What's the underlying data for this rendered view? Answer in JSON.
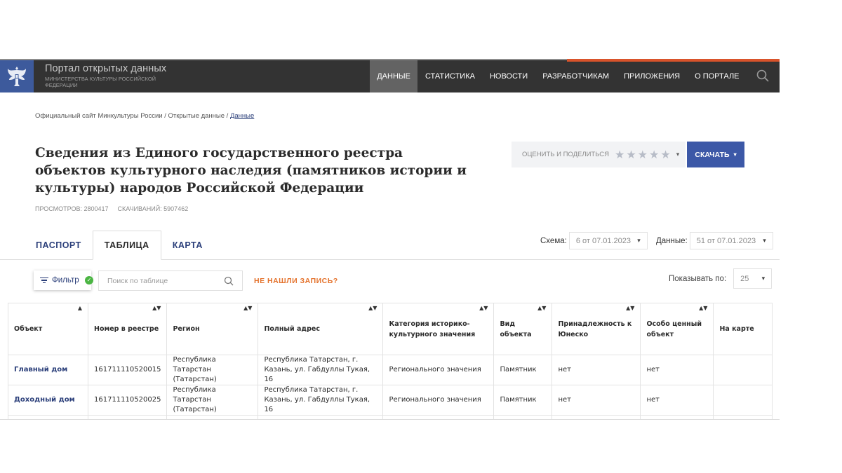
{
  "header": {
    "portal_title": "Портал открытых данных",
    "portal_subtitle": "МИНИСТЕРСТВА КУЛЬТУРЫ РОССИЙСКОЙ ФЕДЕРАЦИИ",
    "nav": [
      {
        "label": "ДАННЫЕ",
        "active": true
      },
      {
        "label": "СТАТИСТИКА",
        "active": false
      },
      {
        "label": "НОВОСТИ",
        "active": false
      },
      {
        "label": "РАЗРАБОТЧИКАМ",
        "active": false
      },
      {
        "label": "ПРИЛОЖЕНИЯ",
        "active": false
      },
      {
        "label": "О ПОРТАЛЕ",
        "active": false
      }
    ],
    "search_icon": "search-icon",
    "accent_color": "#d9532b",
    "brand_color": "#3d5a9c"
  },
  "breadcrumb": {
    "part1": "Официальный сайт Минкультуры России",
    "sep": " / ",
    "part2": "Открытые данные",
    "current": "Данные"
  },
  "dataset": {
    "title": "Сведения из Единого государственного реестра объектов культурного наследия (памятников истории и культуры) народов Российской Федерации",
    "views": "ПРОСМОТРОВ: 2800417",
    "downloads": "СКАЧИВАНИЙ: 5907462"
  },
  "actions": {
    "rate_label": "ОЦЕНИТЬ И ПОДЕЛИТЬСЯ",
    "rating_stars": 5,
    "download_label": "СКАЧАТЬ",
    "download_color": "#3c58a7"
  },
  "tabs": [
    {
      "label": "ПАСПОРТ",
      "active": false
    },
    {
      "label": "ТАБЛИЦА",
      "active": true
    },
    {
      "label": "КАРТА",
      "active": false
    }
  ],
  "versions": {
    "scheme_label": "Схема:",
    "scheme_value": "6 от 07.01.2023",
    "data_label": "Данные:",
    "data_value": "51 от 07.01.2023"
  },
  "toolbar": {
    "filter_label": "Фильтр",
    "search_placeholder": "Поиск по таблице",
    "not_found_label": "НЕ НАШЛИ ЗАПИСЬ?",
    "per_page_label": "Показывать по:",
    "per_page_value": "25"
  },
  "table": {
    "columns": [
      {
        "label": "Объект",
        "sort": "▲"
      },
      {
        "label": "Номер в реестре",
        "sort": "▲▼"
      },
      {
        "label": "Регион",
        "sort": "▲▼"
      },
      {
        "label": "Полный адрес",
        "sort": "▲▼"
      },
      {
        "label": "Категория историко-культурного значения",
        "sort": "▲▼"
      },
      {
        "label": "Вид объекта",
        "sort": "▲▼"
      },
      {
        "label": "Принадлежность к Юнеско",
        "sort": "▲▼"
      },
      {
        "label": "Особо ценный объект",
        "sort": "▲▼"
      },
      {
        "label": "На карте",
        "sort": ""
      }
    ],
    "rows": [
      [
        "Главный дом",
        "161711110520015",
        "Республика Татарстан (Татарстан)",
        "Республика Татарстан, г. Казань, ул. Габдуллы Тукая, 16",
        "Регионального значения",
        "Памятник",
        "нет",
        "нет",
        ""
      ],
      [
        "Доходный дом",
        "161711110520025",
        "Республика Татарстан (Татарстан)",
        "Республика Татарстан, г. Казань, ул. Габдуллы Тукая, 16",
        "Регионального значения",
        "Памятник",
        "нет",
        "нет",
        ""
      ]
    ]
  }
}
